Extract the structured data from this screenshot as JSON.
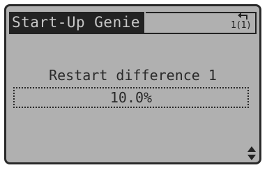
{
  "header": {
    "title": "Start-Up Genie",
    "setup_indicator": "1(1)",
    "back_icon": "back-arrow-icon"
  },
  "parameter": {
    "label": "Restart difference 1",
    "value": "10.0%"
  },
  "footer": {
    "updown_icon": "up-down-arrows-icon"
  },
  "colors": {
    "lcd_background": "#b0b0b0",
    "lcd_foreground": "#222222",
    "inverted_text": "#c8c8c8"
  }
}
